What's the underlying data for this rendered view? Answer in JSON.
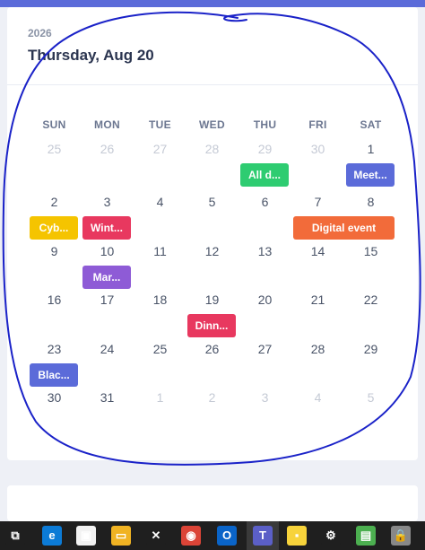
{
  "header": {
    "year": "2026",
    "date_title": "Thursday, Aug 20"
  },
  "weekdays": [
    "SUN",
    "MON",
    "TUE",
    "WED",
    "THU",
    "FRI",
    "SAT"
  ],
  "weeks": [
    [
      {
        "d": "25",
        "muted": true
      },
      {
        "d": "26",
        "muted": true
      },
      {
        "d": "27",
        "muted": true
      },
      {
        "d": "28",
        "muted": true
      },
      {
        "d": "29",
        "muted": true
      },
      {
        "d": "30",
        "muted": true
      },
      {
        "d": "1",
        "muted": false
      }
    ],
    [
      {
        "d": "2",
        "muted": false
      },
      {
        "d": "3",
        "muted": false
      },
      {
        "d": "4",
        "muted": false
      },
      {
        "d": "5",
        "muted": false
      },
      {
        "d": "6",
        "muted": false
      },
      {
        "d": "7",
        "muted": false
      },
      {
        "d": "8",
        "muted": false
      }
    ],
    [
      {
        "d": "9",
        "muted": false
      },
      {
        "d": "10",
        "muted": false
      },
      {
        "d": "11",
        "muted": false
      },
      {
        "d": "12",
        "muted": false
      },
      {
        "d": "13",
        "muted": false
      },
      {
        "d": "14",
        "muted": false
      },
      {
        "d": "15",
        "muted": false
      }
    ],
    [
      {
        "d": "16",
        "muted": false
      },
      {
        "d": "17",
        "muted": false
      },
      {
        "d": "18",
        "muted": false
      },
      {
        "d": "19",
        "muted": false
      },
      {
        "d": "20",
        "muted": false
      },
      {
        "d": "21",
        "muted": false
      },
      {
        "d": "22",
        "muted": false
      }
    ],
    [
      {
        "d": "23",
        "muted": false
      },
      {
        "d": "24",
        "muted": false
      },
      {
        "d": "25",
        "muted": false
      },
      {
        "d": "26",
        "muted": false
      },
      {
        "d": "27",
        "muted": false
      },
      {
        "d": "28",
        "muted": false
      },
      {
        "d": "29",
        "muted": false
      }
    ],
    [
      {
        "d": "30",
        "muted": false
      },
      {
        "d": "31",
        "muted": false
      },
      {
        "d": "1",
        "muted": true
      },
      {
        "d": "2",
        "muted": true
      },
      {
        "d": "3",
        "muted": true
      },
      {
        "d": "4",
        "muted": true
      },
      {
        "d": "5",
        "muted": true
      }
    ]
  ],
  "events": [
    {
      "label": "All d...",
      "week": 0,
      "col": 4,
      "span": 1,
      "color": "#2ecc71"
    },
    {
      "label": "Meet...",
      "week": 0,
      "col": 6,
      "span": 1,
      "color": "#5b6bd9"
    },
    {
      "label": "Cyb...",
      "week": 1,
      "col": 0,
      "span": 1,
      "color": "#f5c400"
    },
    {
      "label": "Wint...",
      "week": 1,
      "col": 1,
      "span": 1,
      "color": "#e8385f"
    },
    {
      "label": "Digital event",
      "week": 1,
      "col": 5,
      "span": 2,
      "color": "#f26b3a"
    },
    {
      "label": "Mar...",
      "week": 2,
      "col": 1,
      "span": 1,
      "color": "#8e5bd6"
    },
    {
      "label": "Dinn...",
      "week": 3,
      "col": 3,
      "span": 1,
      "color": "#e8385f"
    },
    {
      "label": "Blac...",
      "week": 4,
      "col": 0,
      "span": 1,
      "color": "#5b6bd9"
    }
  ],
  "taskbar": {
    "items": [
      {
        "name": "task-view-icon",
        "glyph": "⧉",
        "color": "#1f1f1f"
      },
      {
        "name": "edge-icon",
        "glyph": "e",
        "color": "#0c7bd6"
      },
      {
        "name": "store-icon",
        "glyph": "▣",
        "color": "#f2f2f2"
      },
      {
        "name": "file-explorer-icon",
        "glyph": "▭",
        "color": "#f0b323"
      },
      {
        "name": "xmind-icon",
        "glyph": "✕",
        "color": "#1f1f1f"
      },
      {
        "name": "chrome-icon",
        "glyph": "◉",
        "color": "#db4437"
      },
      {
        "name": "outlook-icon",
        "glyph": "O",
        "color": "#0a64c8"
      },
      {
        "name": "teams-icon",
        "glyph": "T",
        "color": "#5b5fc7"
      },
      {
        "name": "sticky-notes-icon",
        "glyph": "▪",
        "color": "#f7d33b"
      },
      {
        "name": "settings-icon",
        "glyph": "⚙",
        "color": "#1f1f1f"
      },
      {
        "name": "app-store-icon",
        "glyph": "▤",
        "color": "#4caf50"
      },
      {
        "name": "security-lock-icon",
        "glyph": "🔒",
        "color": "#888888"
      }
    ]
  }
}
